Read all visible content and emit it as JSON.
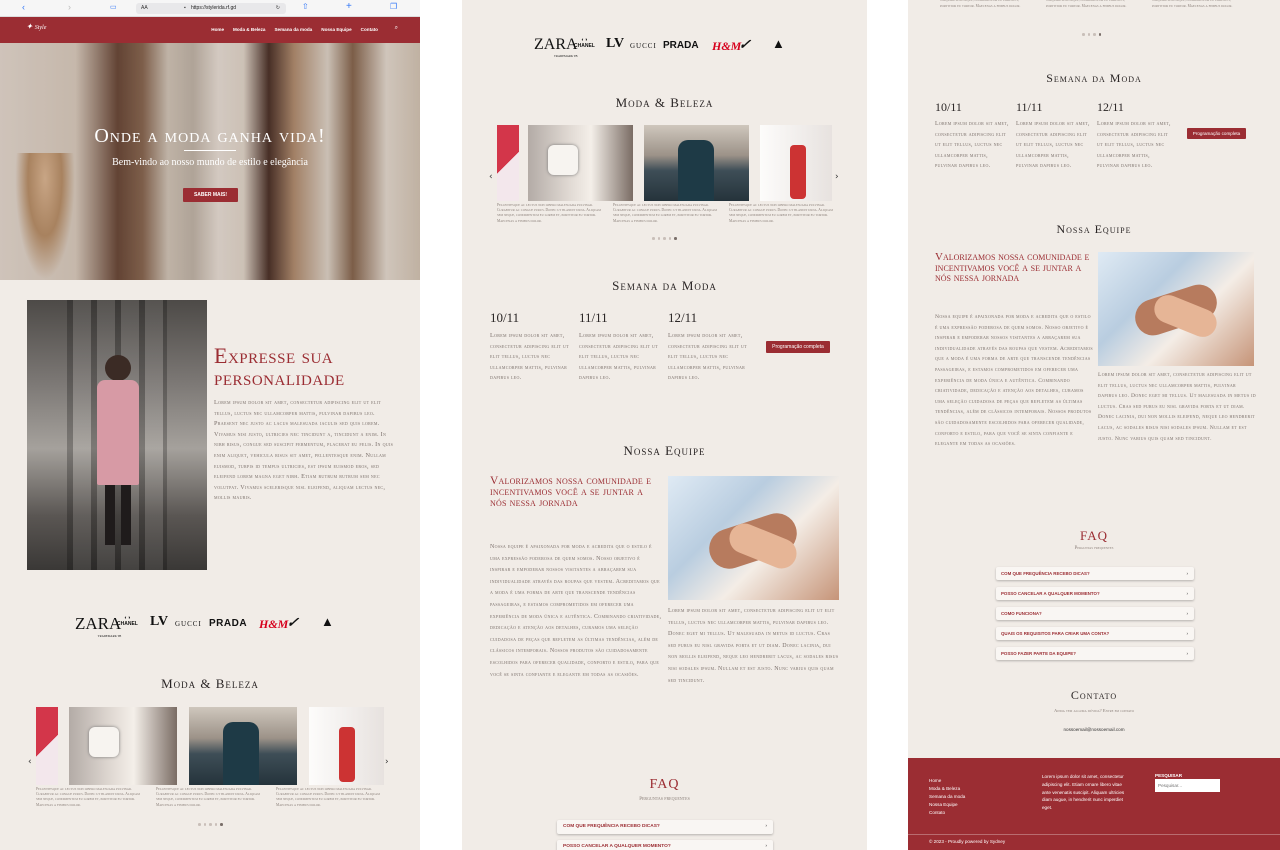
{
  "browser": {
    "aa": "AA",
    "url": "https://stylerida.rf.gd"
  },
  "nav": {
    "items": [
      "Home",
      "Moda & Beleza",
      "Semana da moda",
      "Nossa Equipe",
      "Contato"
    ]
  },
  "hero": {
    "title": "Onde a moda ganha vida!",
    "subtitle": "Bem-vindo ao nosso mundo de estilo e elegância",
    "button": "SABER MAIS!"
  },
  "about": {
    "title_line1": "Expresse sua",
    "title_line2": "personalidade",
    "text": "Lorem ipsum dolor sit amet, consectetur adipiscing elit ut elit tellus, luctus nec ullamcorper mattis, pulvinar dapibus leo. Praesent nec justo ac lacus malesuada iaculis sed quis lorem. Vivamus nisi justo, ultricies nec tincidunt a, tincidunt a enim. In nibh risus, congue sed suscipit fermentum, placerat eu felis. In quis enim aliquet, vehicula risus sit amet, pellentesque enim. Nullam euismod, turpis id tempus ultricies, est ipsum euismod eros, sed eleifend lorem magna eget nibh. Etiam rutrum rutrum sem nec volutpat. Vivamus scelerisque nisl eleifend, aliquam lectus nec, mollis mauris."
  },
  "brands": {
    "zara": "ZARA",
    "zara_sub": "TRADEMARK TB",
    "chanel": "CHANEL",
    "lv": "LV",
    "gucci": "GUCCI",
    "prada": "PRADA",
    "hm": "H&M",
    "nike": "✓",
    "adidas": "▲"
  },
  "moda": {
    "title": "Moda & Beleza",
    "caption": "Pellentesque ac lectus non libero malesuada pulvinar. Curabitur ac congue purus. Donec ut blandit urna. Aliquam sem neque, condimentum eu lorem et, porttitor eu tortor. Maecenas a finibus dolor."
  },
  "semana": {
    "title": "Semana da Moda",
    "dates": [
      "10/11",
      "11/11",
      "12/11"
    ],
    "text": "Lorem ipsum dolor sit amet, consectetur adipiscing elit ut elit tellus, luctus nec ullamcorper mattis, pulvinar dapibus leo.",
    "button": "Programação completa"
  },
  "equipe": {
    "title": "Nossa Equipe",
    "heading": "Valorizamos nossa comunidade e incentivamos você a se juntar a nós nessa jornada",
    "text1": "Nossa equipe é apaixonada por moda e acredita que o estilo é uma expressão poderosa de quem somos. Nosso objetivo é inspirar e empoderar nossos visitantes a abraçarem sua individualidade através das roupas que vestem. Acreditamos que a moda é uma forma de arte que transcende tendências passageiras, e estamos comprometidos em oferecer uma experiência de moda única e autêntica. Combinando criatividade, dedicação e atenção aos detalhes, curamos uma seleção cuidadosa de peças que refletem as últimas tendências, além de clássicos intemporais. Nossos produtos são cuidadosamente escolhidos para oferecer qualidade, conforto e estilo, para que você se sinta confiante e elegante em todas as ocasiões.",
    "text2": "Lorem ipsum dolor sit amet, consectetur adipiscing elit ut elit tellus, luctus nec ullamcorper mattis, pulvinar dapibus leo. Donec eget mi tellus. Ut malesuada in metus id luctus. Cras sed purus eu nisl gravida porta et ut diam. Donec lacinia, dui non mollis eleifend, neque leo hendrerit lacus, ac sodales risus nisi sodales ipsum. Nullam et est justo. Nunc varius quis quam sed tincidunt."
  },
  "faq": {
    "title": "FAQ",
    "subtitle": "Perguntas frequentes",
    "items": [
      "COM QUE FREQUÊNCIA RECEBO DICAS?",
      "POSSO CANCELAR A QUALQUER MOMENTO?",
      "COMO FUNCIONA?",
      "QUAIS OS REQUISITOS PARA CRIAR UMA CONTA?",
      "POSSO FAZER PARTE DA EQUIPE?"
    ]
  },
  "contato": {
    "title": "Contato",
    "subtitle": "Ainda tem alguma dúvida? Entre em contato",
    "email": "nossoemail@nossoemail.com"
  },
  "footer": {
    "links": [
      "Home",
      "Moda & Beleza",
      "Semana da moda",
      "Nossa Equipe",
      "Contato"
    ],
    "text": "Lorem ipsum dolor sit amet, consectetur adipiscing elit. Etiam ornare libero vitae ante venenatis suscipit. Aliquam ultricies diam augue, in hendrerit nunc imperdiet eget.",
    "search_label": "PESQUISAR",
    "search_placeholder": "Pesquisar...",
    "copyright": "© 2023 - Proudly powered by Sydney"
  },
  "colors": {
    "accent": "#9b2d33",
    "bg": "#f1ece7"
  }
}
